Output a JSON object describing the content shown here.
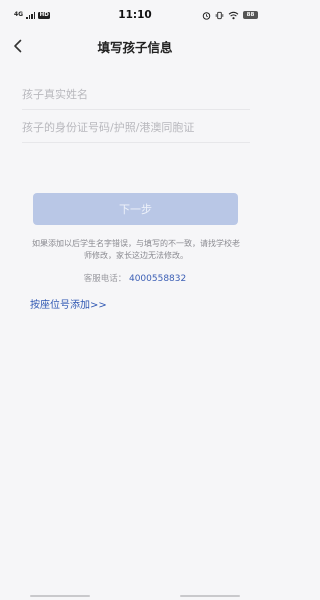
{
  "status_bar": {
    "network": "4G",
    "hd": "HD",
    "time": "11:10",
    "battery": "88"
  },
  "nav": {
    "title": "填写孩子信息",
    "back_icon": "chevron-left-icon"
  },
  "form": {
    "name_field": {
      "placeholder": "孩子真实姓名",
      "value": ""
    },
    "id_field": {
      "placeholder": "孩子的身份证号码/护照/港澳同胞证",
      "value": ""
    }
  },
  "next_button": {
    "label": "下一步",
    "state": "disabled",
    "color": "#b9c7e6"
  },
  "notice": "如果添加以后学生名字错误，与填写的不一致，请找学校老师修改，家长这边无法修改。",
  "service": {
    "label": "客服电话：",
    "phone": "4000558832",
    "phone_color": "#3c5fb5"
  },
  "seat_link": {
    "label": "按座位号添加>>",
    "color": "#2f57b3"
  }
}
